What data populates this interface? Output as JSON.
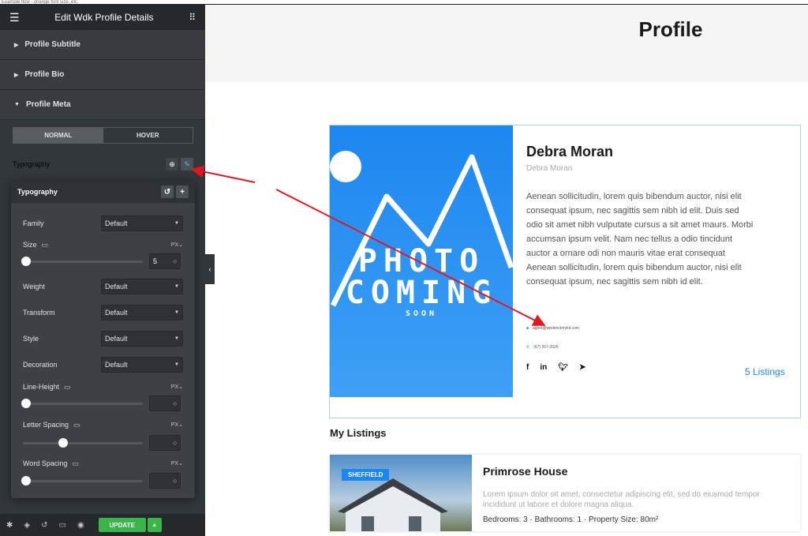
{
  "topnote": "Example flow - change font size, etc.",
  "editor": {
    "title": "Edit Wdk Profile Details",
    "sections": [
      "Profile Subtitle",
      "Profile Bio",
      "Profile Meta"
    ],
    "tabs": {
      "normal": "NORMAL",
      "hover": "HOVER"
    },
    "typography_label": "Typography",
    "popup": {
      "title": "Typography",
      "family_label": "Family",
      "family_value": "Default",
      "size_label": "Size",
      "size_unit": "PX",
      "size_value": "5",
      "weight_label": "Weight",
      "weight_value": "Default",
      "transform_label": "Transform",
      "transform_value": "Default",
      "style_label": "Style",
      "style_value": "Default",
      "decoration_label": "Decoration",
      "decoration_value": "Default",
      "line_height_label": "Line-Height",
      "line_height_unit": "PX",
      "letter_spacing_label": "Letter Spacing",
      "letter_spacing_unit": "PX",
      "word_spacing_label": "Word Spacing",
      "word_spacing_unit": "PX"
    },
    "footer": {
      "update": "UPDATE"
    }
  },
  "page": {
    "heading": "Profile",
    "profile": {
      "photo_line1": "PHOTO",
      "photo_line2": "COMING",
      "photo_line3": "SOON",
      "name": "Debra Moran",
      "subtitle": "Debra Moran",
      "bio": "Aenean sollicitudin, lorem quis bibendum auctor, nisi elit consequat ipsum, nec sagittis sem nibh id elit. Duis sed odio sit amet nibh vulputate cursus a sit amet maurs. Morbi accumsan ipsum velit. Nam nec tellus a odio tincidunt auctor a ornare odi non mauris vitae erat consequat Aenean sollicitudin, lorem quis bibendum auctor, nisi elit consequat ipsum, nec sagittis sem nibh id elit.",
      "email": "agent@wpdirectorykit.com",
      "phone": "(67) 267-2026",
      "listings_link": "5 Listings"
    },
    "my_listings_heading": "My Listings",
    "listing": {
      "badge": "SHEFFIELD",
      "title": "Primrose House",
      "description": "Lorem ipsum dolor sit amet, consectetur adipiscing elit, sed do eiusmod tempor incididunt ut labore et dolore magna aliqua.",
      "features": "Bedrooms: 3  ·  Bathrooms: 1  ·  Property Size: 80m²"
    }
  },
  "colors": {
    "accent": "#1d87f0",
    "update_green": "#39b54a",
    "arrow": "#e8141c"
  }
}
